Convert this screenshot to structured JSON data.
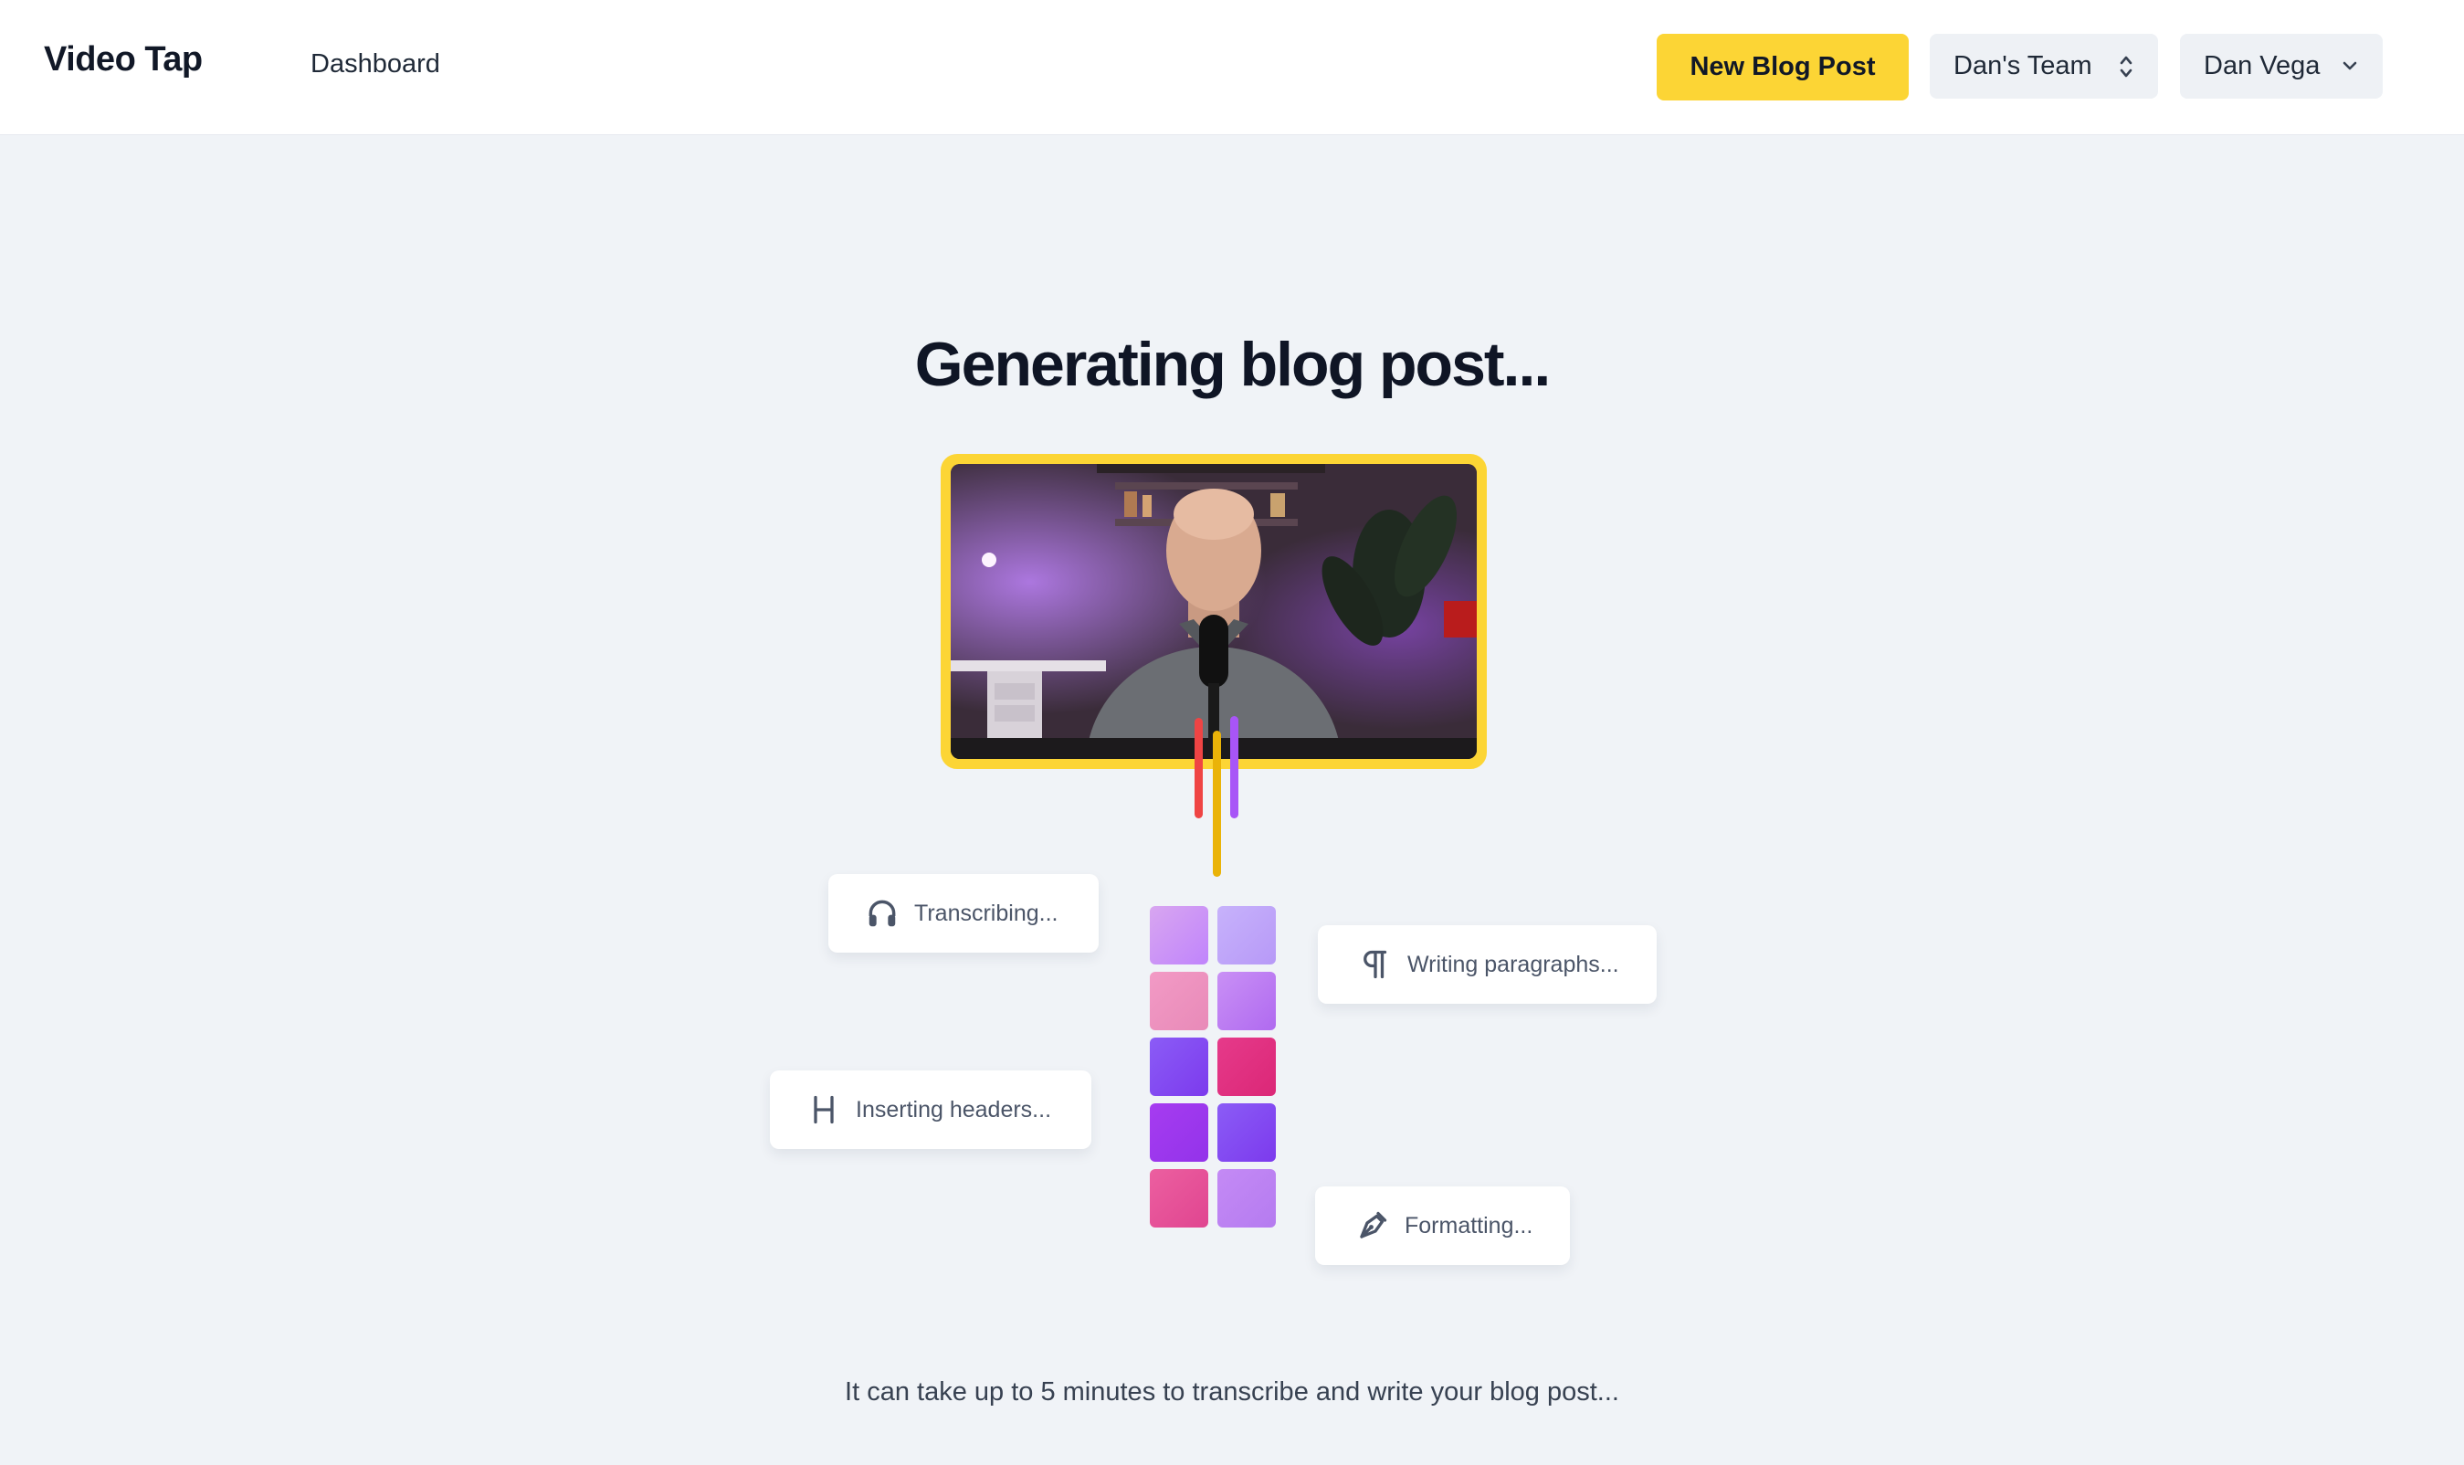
{
  "header": {
    "logo": "Video Tap",
    "nav_dashboard": "Dashboard",
    "new_post_label": "New Blog Post",
    "team_label": "Dan's Team",
    "user_label": "Dan Vega"
  },
  "main": {
    "title": "Generating blog post...",
    "steps": {
      "transcribing": "Transcribing...",
      "writing": "Writing paragraphs...",
      "headers": "Inserting headers...",
      "formatting": "Formatting..."
    },
    "footer_note": "It can take up to 5 minutes to transcribe and write your blog post..."
  },
  "colors": {
    "accent": "#fcd535",
    "line_red": "#ef4444",
    "line_yellow": "#eab308",
    "line_purple": "#a855f7"
  },
  "icons": [
    "headphones-icon",
    "paragraph-icon",
    "heading-icon",
    "pen-nib-icon",
    "chevron-up-down-icon",
    "chevron-down-icon"
  ]
}
